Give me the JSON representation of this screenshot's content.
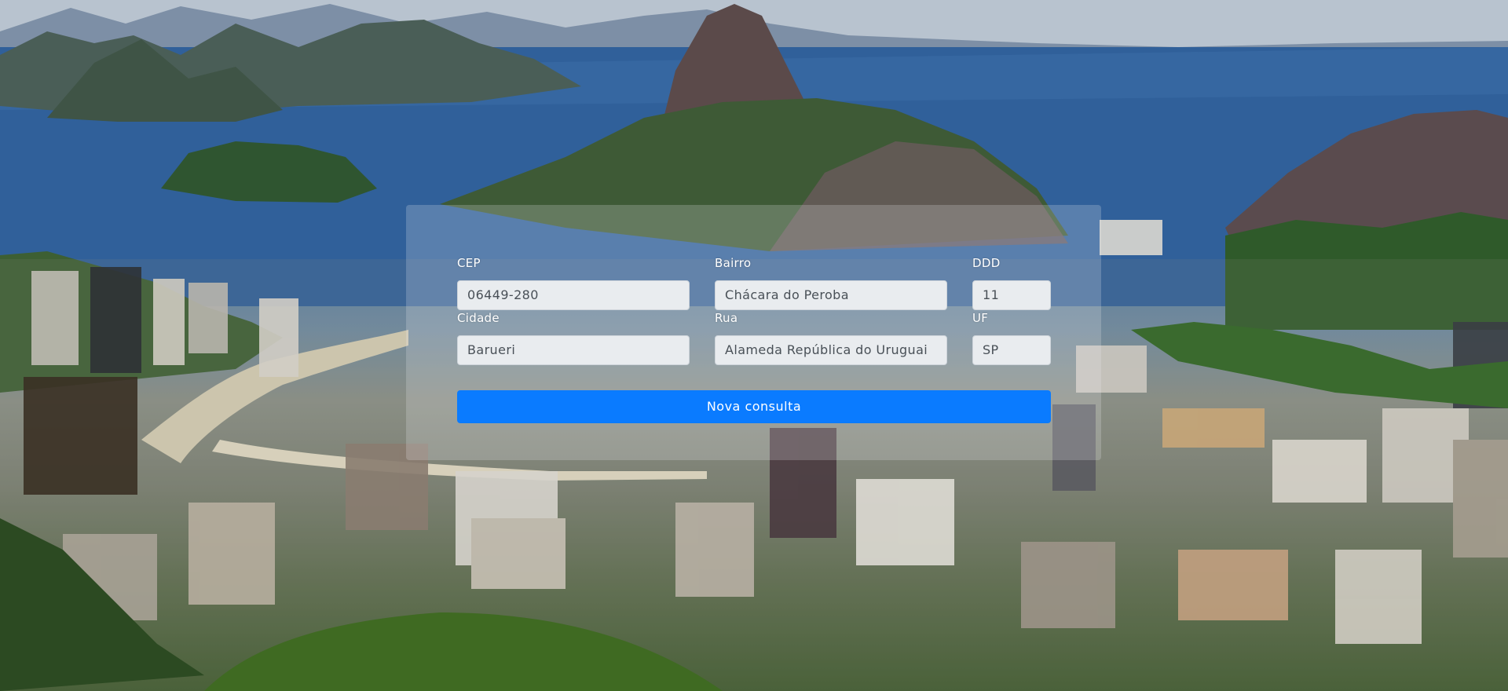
{
  "form": {
    "cep": {
      "label": "CEP",
      "value": "06449-280"
    },
    "bairro": {
      "label": "Bairro",
      "value": "Chácara do Peroba"
    },
    "ddd": {
      "label": "DDD",
      "value": "11"
    },
    "cidade": {
      "label": "Cidade",
      "value": "Barueri"
    },
    "rua": {
      "label": "Rua",
      "value": "Alameda República do Uruguai"
    },
    "uf": {
      "label": "UF",
      "value": "SP"
    },
    "submit_label": "Nova consulta"
  },
  "colors": {
    "primary": "#0a7bff",
    "field_background": "#e9ecef",
    "field_text": "#495057",
    "label_text": "#ffffff"
  }
}
